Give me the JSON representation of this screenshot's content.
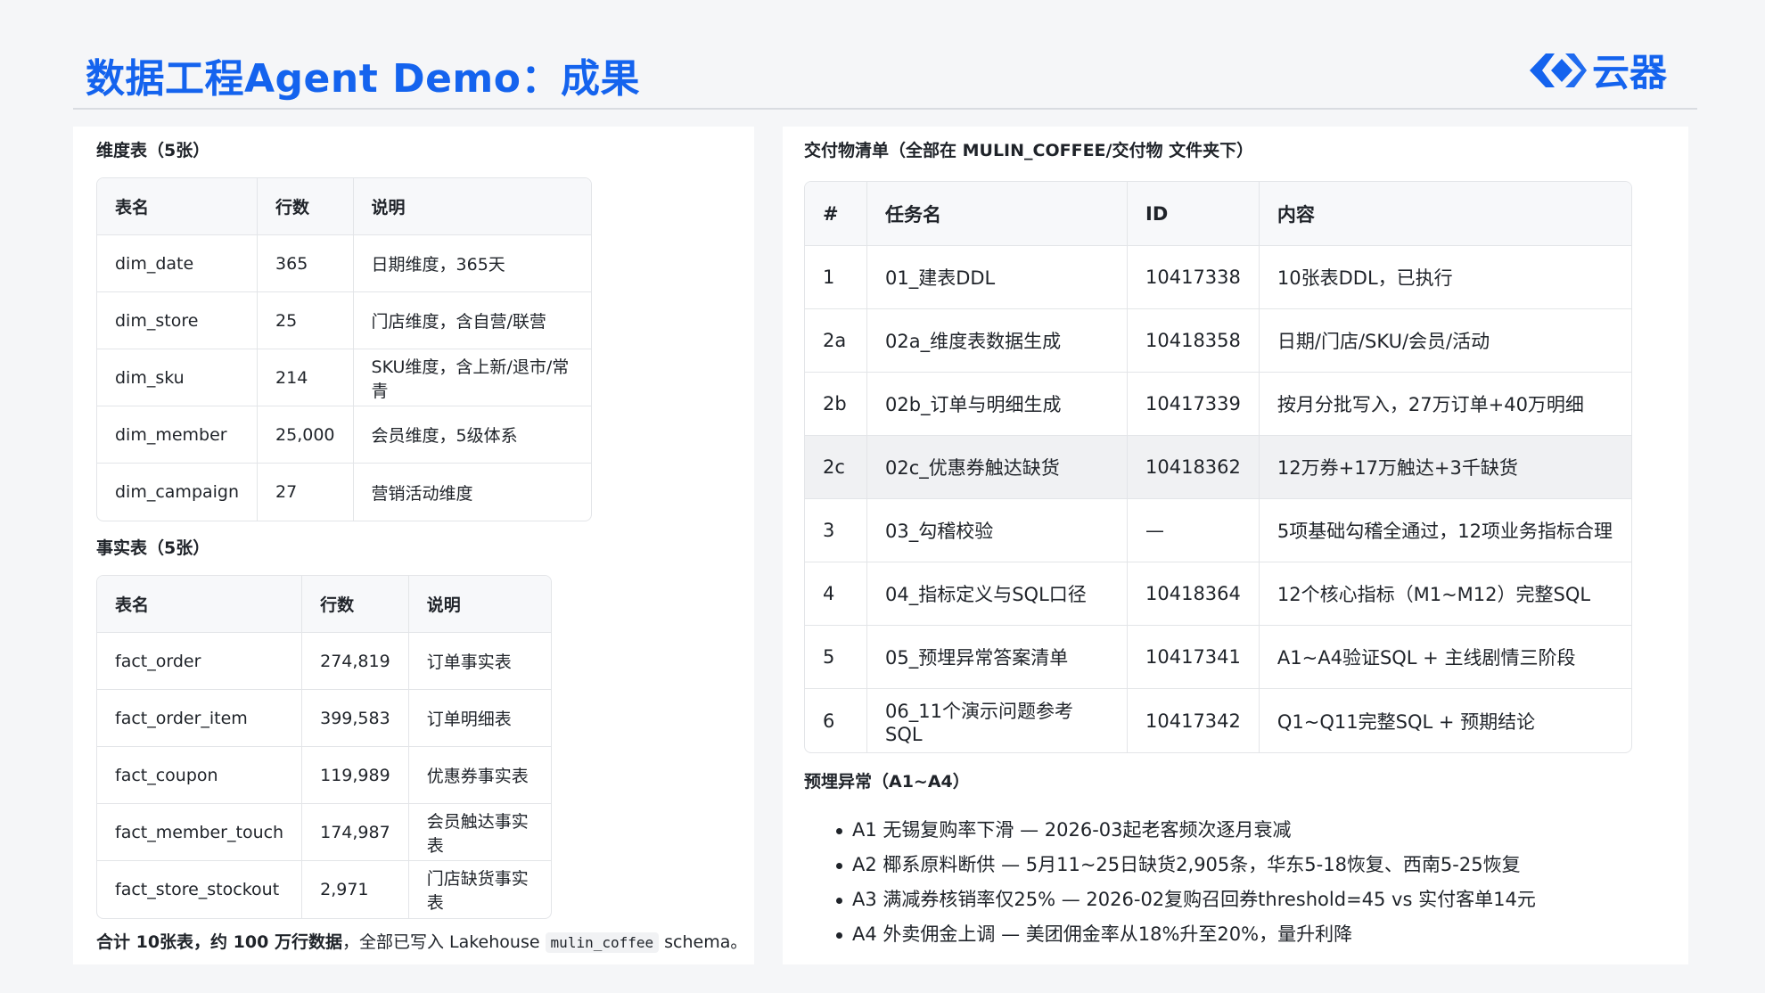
{
  "header": {
    "title": "数据工程Agent Demo：成果",
    "logo_text": "云器",
    "accent_color": "#1463ee"
  },
  "dim_tables": {
    "title": "维度表（5张）",
    "columns": [
      "表名",
      "行数",
      "说明"
    ],
    "rows": [
      [
        "dim_date",
        "365",
        "日期维度，365天"
      ],
      [
        "dim_store",
        "25",
        "门店维度，含自营/联营"
      ],
      [
        "dim_sku",
        "214",
        "SKU维度，含上新/退市/常青"
      ],
      [
        "dim_member",
        "25,000",
        "会员维度，5级体系"
      ],
      [
        "dim_campaign",
        "27",
        "营销活动维度"
      ]
    ]
  },
  "fact_tables": {
    "title": "事实表（5张）",
    "columns": [
      "表名",
      "行数",
      "说明"
    ],
    "rows": [
      [
        "fact_order",
        "274,819",
        "订单事实表"
      ],
      [
        "fact_order_item",
        "399,583",
        "订单明细表"
      ],
      [
        "fact_coupon",
        "119,989",
        "优惠券事实表"
      ],
      [
        "fact_member_touch",
        "174,987",
        "会员触达事实表"
      ],
      [
        "fact_store_stockout",
        "2,971",
        "门店缺货事实表"
      ]
    ]
  },
  "summary": {
    "bold": "合计 10张表，约 100 万行数据",
    "middle": "，全部已写入 Lakehouse",
    "code": "mulin_coffee",
    "tail": "schema。"
  },
  "deliverables": {
    "title": "交付物清单（全部在 MULIN_COFFEE/交付物 文件夹下）",
    "columns": [
      "#",
      "任务名",
      "ID",
      "内容"
    ],
    "rows": [
      [
        "1",
        "01_建表DDL",
        "10417338",
        "10张表DDL，已执行"
      ],
      [
        "2a",
        "02a_维度表数据生成",
        "10418358",
        "日期/门店/SKU/会员/活动"
      ],
      [
        "2b",
        "02b_订单与明细生成",
        "10417339",
        "按月分批写入，27万订单+40万明细"
      ],
      [
        "2c",
        "02c_优惠券触达缺货",
        "10418362",
        "12万券+17万触达+3千缺货"
      ],
      [
        "3",
        "03_勾稽校验",
        "—",
        "5项基础勾稽全通过，12项业务指标合理"
      ],
      [
        "4",
        "04_指标定义与SQL口径",
        "10418364",
        "12个核心指标（M1~M12）完整SQL"
      ],
      [
        "5",
        "05_预埋异常答案清单",
        "10417341",
        "A1~A4验证SQL + 主线剧情三阶段"
      ],
      [
        "6",
        "06_11个演示问题参考SQL",
        "10417342",
        "Q1~Q11完整SQL + 预期结论"
      ]
    ],
    "highlighted_row": 3
  },
  "anomalies": {
    "title": "预埋异常（A1~A4）",
    "items": [
      "A1 无锡复购率下滑 — 2026-03起老客频次逐月衰减",
      "A2 椰系原料断供 — 5月11~25日缺货2,905条，华东5-18恢复、西南5-25恢复",
      "A3 满减券核销率仅25% — 2026-02复购召回券threshold=45 vs 实付客单14元",
      "A4 外卖佣金上调 — 美团佣金率从18%升至20%，量升利降"
    ]
  }
}
